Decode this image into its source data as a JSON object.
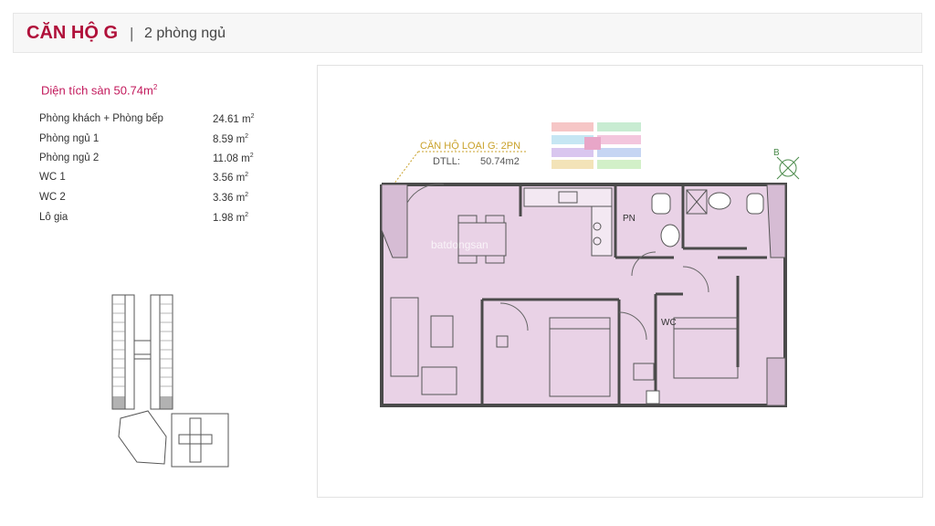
{
  "header": {
    "title": "CĂN HỘ G",
    "separator": "|",
    "subtitle": "2 phòng ngủ"
  },
  "area": {
    "label": "Diện tích sàn 50.74m",
    "unit_sup": "2"
  },
  "rooms": [
    {
      "name": "Phòng khách + Phòng bếp",
      "value": "24.61 m",
      "sup": "2"
    },
    {
      "name": "Phòng ngủ 1",
      "value": "8.59 m",
      "sup": "2"
    },
    {
      "name": "Phòng ngủ 2",
      "value": "11.08 m",
      "sup": "2"
    },
    {
      "name": "WC 1",
      "value": "3.56 m",
      "sup": "2"
    },
    {
      "name": "WC 2",
      "value": "3.36 m",
      "sup": "2"
    },
    {
      "name": "Lô gia",
      "value": "1.98 m",
      "sup": "2"
    }
  ],
  "plan": {
    "unit_label": "CĂN HỘ LOẠI G: 2PN",
    "dtll_label": "DTLL:",
    "dtll_value": "50.74m2",
    "compass": "B",
    "label_pn": "PN",
    "label_wc": "WC",
    "watermark": "batdongsan",
    "fill_color": "#e9d2e6",
    "wall_color": "#4a4a4a",
    "accent_color": "#c9a12a"
  }
}
